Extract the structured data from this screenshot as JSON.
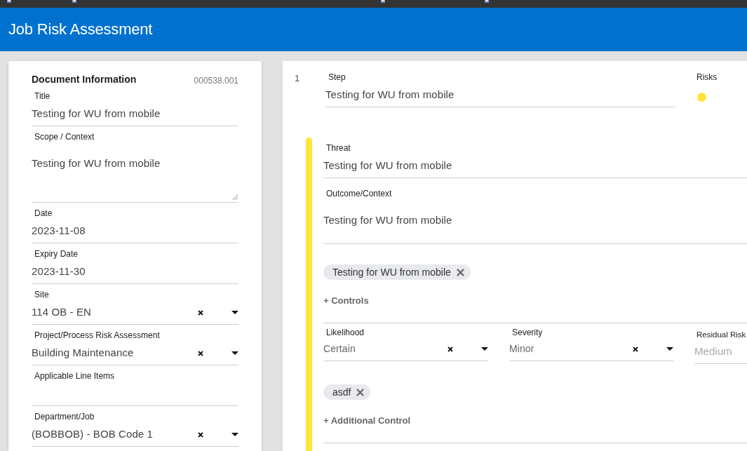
{
  "header": {
    "title": "Job Risk Assessment"
  },
  "document": {
    "heading": "Document Information",
    "number": "000538.001",
    "fields": [
      {
        "kind": "text",
        "label": "Title",
        "value": "Testing for WU from mobile"
      },
      {
        "kind": "textarea",
        "label": "Scope / Context",
        "value": "Testing for WU from mobile"
      },
      {
        "kind": "text",
        "label": "Date",
        "value": "2023-11-08"
      },
      {
        "kind": "text",
        "label": "Expiry Date",
        "value": "2023-11-30"
      },
      {
        "kind": "select",
        "label": "Site",
        "value": "114 OB - EN"
      },
      {
        "kind": "select",
        "label": "Project/Process Risk Assessment",
        "value": "Building Maintenance"
      },
      {
        "kind": "text",
        "label": "Applicable Line Items"
      },
      {
        "kind": "select",
        "label": "Department/Job",
        "value": "(BOBBOB) - BOB Code 1"
      }
    ]
  },
  "steps": [
    {
      "number": "1",
      "step": {
        "label": "Step",
        "value": "Testing for WU from mobile"
      },
      "risks_label": "Risks",
      "risks": [
        {
          "color": "#ffe53b"
        }
      ],
      "threats": [
        {
          "color": "#ffe53b",
          "fields": [
            {
              "kind": "text",
              "label": "Threat",
              "value": "Testing for WU from mobile"
            },
            {
              "kind": "textarea",
              "label": "Outcome/Context",
              "value": "Testing for WU from mobile"
            }
          ],
          "controls": [
            {
              "label": "Testing for WU from mobile"
            }
          ],
          "add_controls": "+ Controls",
          "rating": [
            {
              "kind": "select",
              "label": "Likelihood",
              "value": "Certain"
            },
            {
              "kind": "select",
              "label": "Severity",
              "value": "Minor"
            },
            {
              "kind": "readonly",
              "label": "Residual Risk",
              "value": "Medium"
            }
          ],
          "additional_controls": [
            {
              "label": "asdf"
            }
          ],
          "add_additional": "+ Additional Control"
        }
      ]
    }
  ]
}
